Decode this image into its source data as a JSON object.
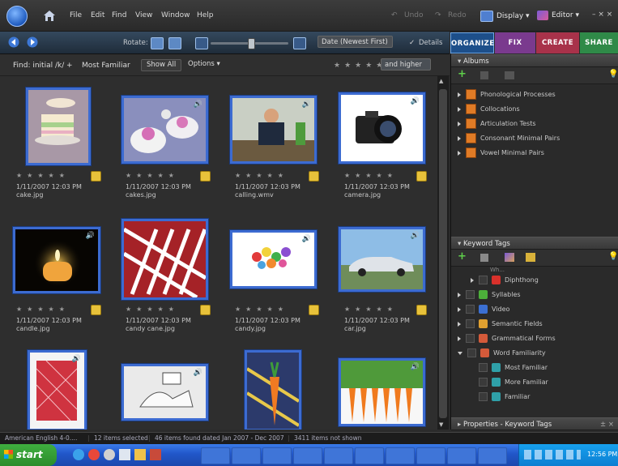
{
  "menubar": {
    "menus": [
      "File",
      "Edit",
      "Find",
      "View",
      "Window",
      "Help"
    ],
    "undo": "Undo",
    "redo": "Redo",
    "display": "Display ▾",
    "editor": "Editor ▾",
    "window_controls": "– × ×"
  },
  "toolbar": {
    "rotate_label": "Rotate:",
    "sort": "Date (Newest First)",
    "details_check": "✓",
    "details": "Details"
  },
  "mode_tabs": [
    {
      "label": "ORGANIZE",
      "color": "#1d4f8a"
    },
    {
      "label": "FIX",
      "color": "#7a3a8e"
    },
    {
      "label": "CREATE",
      "color": "#a8324a"
    },
    {
      "label": "SHARE",
      "color": "#2f8a48"
    }
  ],
  "findbar": {
    "find": "Find: initial /k/",
    "plus": "+",
    "term": "Most Familiar",
    "show_all": "Show All",
    "options": "Options ▾",
    "stars": "★★★★★",
    "rating_filter": "and higher"
  },
  "photos": [
    {
      "date": "1/11/2007 12:03 PM",
      "name": "cake.jpg",
      "audio": false
    },
    {
      "date": "1/11/2007 12:03 PM",
      "name": "cakes.jpg",
      "audio": true
    },
    {
      "date": "1/11/2007 12:03 PM",
      "name": "calling.wmv",
      "audio": true
    },
    {
      "date": "1/11/2007 12:03 PM",
      "name": "camera.jpg",
      "audio": true
    },
    {
      "date": "1/11/2007 12:03 PM",
      "name": "candle.jpg",
      "audio": true
    },
    {
      "date": "1/11/2007 12:03 PM",
      "name": "candy cane.jpg",
      "audio": false
    },
    {
      "date": "1/11/2007 12:03 PM",
      "name": "candy.jpg",
      "audio": true
    },
    {
      "date": "1/11/2007 12:03 PM",
      "name": "car.jpg",
      "audio": true
    },
    {
      "audio": true
    },
    {
      "audio": true
    },
    {
      "audio": false
    },
    {
      "audio": true
    }
  ],
  "albums": {
    "title": "Albums",
    "items": [
      "Phonological Processes",
      "Collocations",
      "Articulation Tests",
      "Consonant Minimal Pairs",
      "Vowel Minimal Pairs"
    ]
  },
  "keyword_tags": {
    "title": "Keyword Tags",
    "partial": "Wh...",
    "items": [
      {
        "label": "Diphthong",
        "color": "#d9312b",
        "indent": 1
      },
      {
        "label": "Syllables",
        "color": "#4caf3a",
        "indent": 0
      },
      {
        "label": "Video",
        "color": "#3b6fd1",
        "indent": 0
      },
      {
        "label": "Semantic Fields",
        "color": "#e0a030",
        "indent": 0
      },
      {
        "label": "Grammatical Forms",
        "color": "#d45a3a",
        "indent": 0
      },
      {
        "label": "Word Familiarity",
        "color": "#d45a3a",
        "indent": 0
      },
      {
        "label": "Most Familiar",
        "color": "#2fa0a8",
        "indent": 1
      },
      {
        "label": "More Familiar",
        "color": "#2fa0a8",
        "indent": 1
      },
      {
        "label": "Familiar",
        "color": "#2fa0a8",
        "indent": 1
      }
    ]
  },
  "properties": {
    "title": "Properties - Keyword Tags",
    "controls": "± ×"
  },
  "status": {
    "lang": "American English 4-0....",
    "selected": "12 items selected",
    "found": "46 items found dated Jan 2007 - Dec 2007",
    "not_shown": "3411 items not shown"
  },
  "taskbar": {
    "start": "start",
    "clock": "12:56 PM"
  }
}
